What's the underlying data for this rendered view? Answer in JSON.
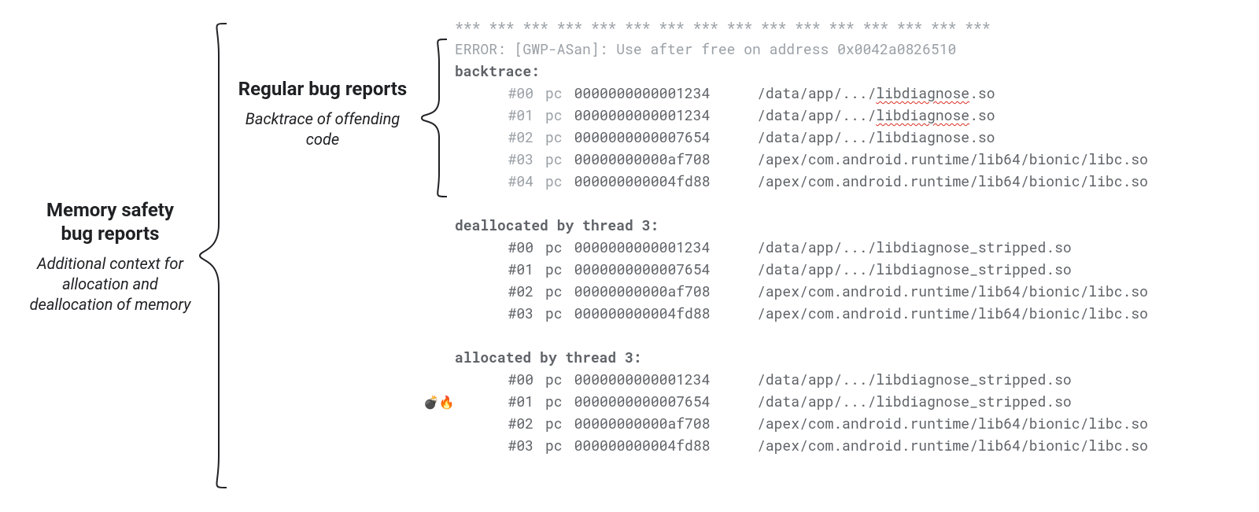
{
  "left_label": {
    "title": "Memory safety bug reports",
    "subtitle": "Additional context for allocation and deallocation of memory"
  },
  "mid_label": {
    "title": "Regular bug reports",
    "subtitle": "Backtrace of offending code"
  },
  "code": {
    "separator": "*** *** *** *** *** *** *** *** *** *** *** *** *** *** *** ***",
    "error_line": "ERROR: [GWP-ASan]: Use after free on address 0x0042a0826510",
    "backtrace_hdr": "backtrace:",
    "dealloc_hdr": "deallocated by thread 3:",
    "alloc_hdr": "allocated by thread 3:",
    "backtrace": [
      {
        "frame": "#00",
        "pc": "pc",
        "addr": "0000000000001234",
        "path_prefix": "/data/app/.../",
        "path_tail": "libdiagnose",
        "path_suffix": ".so",
        "squiggle": true
      },
      {
        "frame": "#01",
        "pc": "pc",
        "addr": "0000000000001234",
        "path_prefix": "/data/app/.../",
        "path_tail": "libdiagnose",
        "path_suffix": ".so",
        "squiggle": true
      },
      {
        "frame": "#02",
        "pc": "pc",
        "addr": "0000000000007654",
        "path_prefix": "/data/app/.../",
        "path_tail": "libdiagnose",
        "path_suffix": ".so",
        "squiggle": false
      },
      {
        "frame": "#03",
        "pc": "pc",
        "addr": "00000000000af708",
        "path_prefix": "/apex/com.android.runtime/lib64/bionic/",
        "path_tail": "libc",
        "path_suffix": ".so",
        "squiggle": false
      },
      {
        "frame": "#04",
        "pc": "pc",
        "addr": "000000000004fd88",
        "path_prefix": "/apex/com.android.runtime/lib64/bionic/",
        "path_tail": "libc",
        "path_suffix": ".so",
        "squiggle": false
      }
    ],
    "dealloc": [
      {
        "frame": "#00",
        "pc": "pc",
        "addr": "0000000000001234",
        "path": "/data/app/.../libdiagnose_stripped.so"
      },
      {
        "frame": "#01",
        "pc": "pc",
        "addr": "0000000000007654",
        "path": "/data/app/.../libdiagnose_stripped.so"
      },
      {
        "frame": "#02",
        "pc": "pc",
        "addr": "00000000000af708",
        "path": "/apex/com.android.runtime/lib64/bionic/libc.so"
      },
      {
        "frame": "#03",
        "pc": "pc",
        "addr": "000000000004fd88",
        "path": "/apex/com.android.runtime/lib64/bionic/libc.so"
      }
    ],
    "alloc": [
      {
        "frame": "#00",
        "pc": "pc",
        "addr": "0000000000001234",
        "path": "/data/app/.../libdiagnose_stripped.so",
        "bomb": false
      },
      {
        "frame": "#01",
        "pc": "pc",
        "addr": "0000000000007654",
        "path": "/data/app/.../libdiagnose_stripped.so",
        "bomb": true
      },
      {
        "frame": "#02",
        "pc": "pc",
        "addr": "00000000000af708",
        "path": "/apex/com.android.runtime/lib64/bionic/libc.so",
        "bomb": false
      },
      {
        "frame": "#03",
        "pc": "pc",
        "addr": "000000000004fd88",
        "path": "/apex/com.android.runtime/lib64/bionic/libc.so",
        "bomb": false
      }
    ],
    "bomb_emoji": "💣🔥"
  }
}
